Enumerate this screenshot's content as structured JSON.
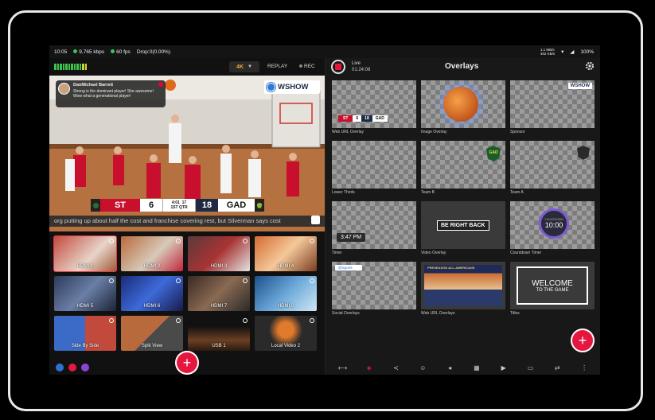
{
  "status": {
    "time": "10:05",
    "bitrate": "9,765 kbps",
    "fps": "60 fps",
    "drop": "Drop:0(0.00%)",
    "net_up": "1.1 MB/s",
    "net_down": "462 KB/s",
    "battery": "100%"
  },
  "controls": {
    "quality": "4K",
    "replay": "REPLAY",
    "rec": "REC"
  },
  "preview": {
    "comment_name": "DanMichael Barrett",
    "comment_text": "Strong is the dominant player! She awesome! Wow what a generational player!",
    "brand": "WSHOW",
    "score": {
      "team1": "ST",
      "score1": "6",
      "clock": "4:01",
      "shot": "17",
      "period": "1ST QTR",
      "score2": "18",
      "team2": "GAD"
    },
    "ticker": "org putting up about half the cost and franchise covering rest, but Silverman says cost"
  },
  "sources": [
    {
      "label": "HDMI 1",
      "selected": true
    },
    {
      "label": "HDMI 2"
    },
    {
      "label": "HDMI 3"
    },
    {
      "label": "HDMI 4"
    },
    {
      "label": "HDMI 5"
    },
    {
      "label": "HDMI 6"
    },
    {
      "label": "HDMI 7"
    },
    {
      "label": "HDMI 8"
    },
    {
      "label": "Side By Side"
    },
    {
      "label": "Split View"
    },
    {
      "label": "USB 1"
    },
    {
      "label": "Local Video 2"
    }
  ],
  "live": {
    "label": "Live",
    "time": "01:24:08"
  },
  "overlays": {
    "title": "Overlays",
    "items": [
      {
        "caption": "Web URL Overlay"
      },
      {
        "caption": "Image Overlay"
      },
      {
        "caption": "Sponsor",
        "badge": "WSHOW"
      },
      {
        "caption": "Lower Thirds"
      },
      {
        "caption": "Team B"
      },
      {
        "caption": "Team A"
      },
      {
        "caption": "Timer",
        "value": "3:47 PM"
      },
      {
        "caption": "Video Overlay",
        "value": "BE RIGHT BACK"
      },
      {
        "caption": "Countdown Timer",
        "value": "10:00",
        "small": "COUNTDOWN"
      },
      {
        "caption": "Social Overlays",
        "value": "@Sports"
      },
      {
        "caption": "Web URL Overlays",
        "value": "PRESEASON ALL-AMERICANS"
      },
      {
        "caption": "Titles",
        "value": "WELCOME",
        "sub": "TO THE GAME"
      }
    ],
    "mini_score": {
      "t1": "ST",
      "s1": "6",
      "s2": "18",
      "t2": "GAD"
    },
    "team_b_logo": "GAD"
  },
  "colors": {
    "accent": "#e5173f",
    "meter_green": "#3cc44b",
    "quality": "#f1a631"
  }
}
